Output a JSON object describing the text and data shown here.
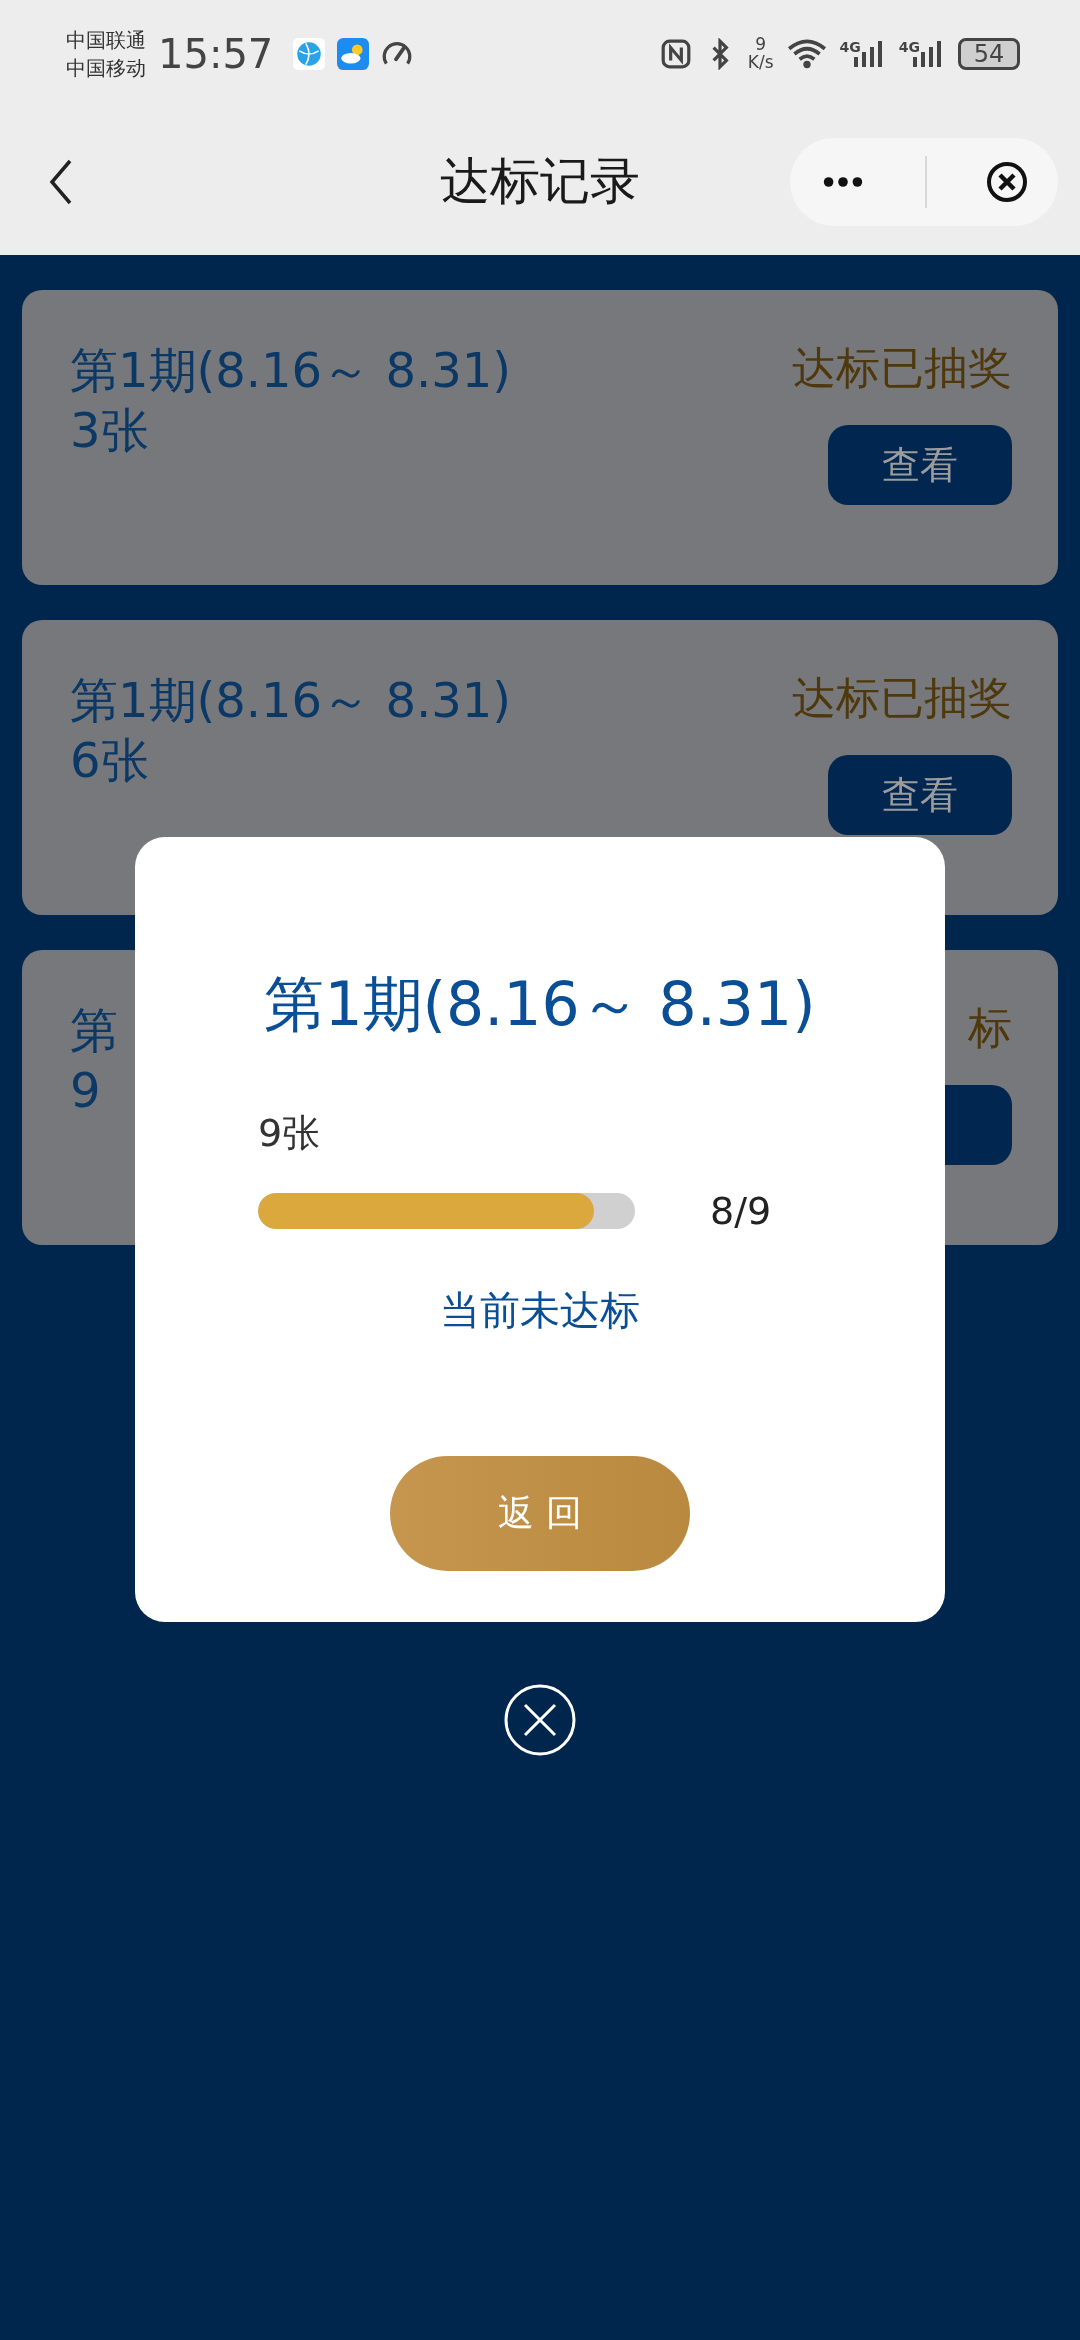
{
  "status_bar": {
    "carriers": [
      "中国联通",
      "中国移动"
    ],
    "time": "15:57",
    "net_speed": [
      "9",
      "K/s"
    ],
    "network": [
      "4G",
      "4G"
    ],
    "battery": "54"
  },
  "nav": {
    "title": "达标记录"
  },
  "records": [
    {
      "title": "第1期(8.16～ 8.31)",
      "count": "3张",
      "status": "达标已抽奖",
      "button": "查看"
    },
    {
      "title": "第1期(8.16～ 8.31)",
      "count": "6张",
      "status": "达标已抽奖",
      "button": "查看"
    },
    {
      "title": "第",
      "count": "9",
      "status": "标"
    }
  ],
  "dialog": {
    "title": "第1期(8.16～ 8.31)",
    "count": "9张",
    "progress": {
      "level": 0.89,
      "reading": "8/9"
    },
    "message": "当前未达标",
    "button": "返 回"
  }
}
